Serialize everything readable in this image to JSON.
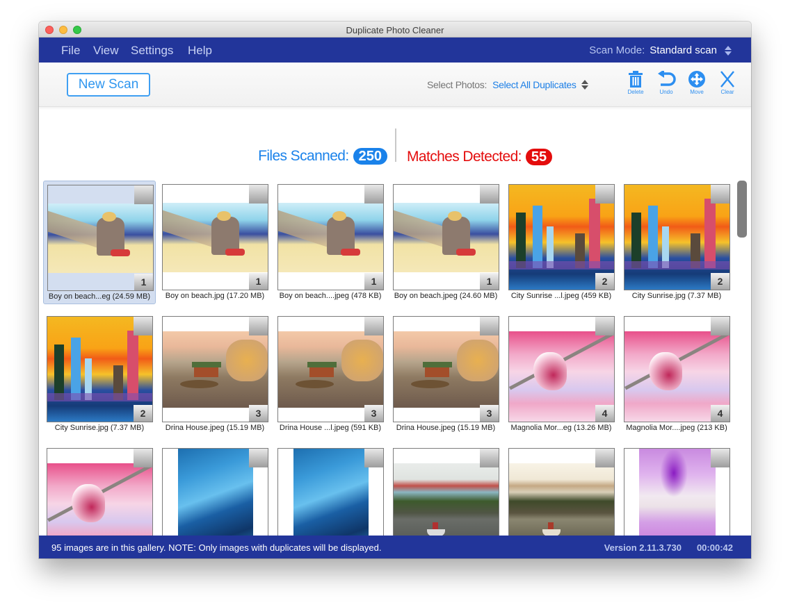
{
  "window": {
    "title": "Duplicate Photo Cleaner"
  },
  "menu": {
    "items": [
      {
        "label": "File"
      },
      {
        "label": "View"
      },
      {
        "label": "Settings"
      },
      {
        "label": "Help"
      }
    ],
    "scan_mode_label": "Scan Mode:",
    "scan_mode_value": "Standard scan"
  },
  "toolbar": {
    "new_scan_label": "New Scan",
    "select_photos_label": "Select Photos:",
    "select_photos_value": "Select All Duplicates",
    "tools": [
      {
        "label": "Delete",
        "icon": "trash-icon"
      },
      {
        "label": "Undo",
        "icon": "undo-icon"
      },
      {
        "label": "Move",
        "icon": "move-icon"
      },
      {
        "label": "Clear",
        "icon": "clear-icon"
      }
    ],
    "accent_color": "#2c8ef0"
  },
  "stats": {
    "files_scanned_label": "Files Scanned:",
    "files_scanned_value": "250",
    "matches_label": "Matches Detected:",
    "matches_value": "55"
  },
  "gallery": {
    "items": [
      {
        "caption": "Boy on beach...eg (24.59 MB)",
        "group": "1",
        "image": "beach",
        "selected": true
      },
      {
        "caption": "Boy on beach.jpg (17.20 MB)",
        "group": "1",
        "image": "beach"
      },
      {
        "caption": "Boy on beach....jpeg (478 KB)",
        "group": "1",
        "image": "beach"
      },
      {
        "caption": "Boy on beach.jpeg (24.60 MB)",
        "group": "1",
        "image": "beach"
      },
      {
        "caption": "City Sunrise ...l.jpeg (459 KB)",
        "group": "2",
        "image": "city"
      },
      {
        "caption": "City Sunrise.jpg (7.37 MB)",
        "group": "2",
        "image": "city"
      },
      {
        "caption": "City Sunrise.jpg (7.37 MB)",
        "group": "2",
        "image": "city"
      },
      {
        "caption": "Drina House.jpeg (15.19 MB)",
        "group": "3",
        "image": "house"
      },
      {
        "caption": "Drina House ...l.jpeg (591 KB)",
        "group": "3",
        "image": "house"
      },
      {
        "caption": "Drina House.jpeg (15.19 MB)",
        "group": "3",
        "image": "house"
      },
      {
        "caption": "Magnolia Mor...eg (13.26 MB)",
        "group": "4",
        "image": "magnolia"
      },
      {
        "caption": "Magnolia Mor....jpeg (213 KB)",
        "group": "4",
        "image": "magnolia"
      },
      {
        "caption": "",
        "group": "",
        "image": "magnolia"
      },
      {
        "caption": "",
        "group": "",
        "image": "wave"
      },
      {
        "caption": "",
        "group": "",
        "image": "wave"
      },
      {
        "caption": "",
        "group": "",
        "image": "harbor"
      },
      {
        "caption": "",
        "group": "",
        "image": "harbor-warm"
      },
      {
        "caption": "",
        "group": "",
        "image": "wisteria"
      }
    ]
  },
  "status": {
    "text": "95 images are in this gallery. NOTE: Only images with duplicates will be displayed.",
    "version": "Version 2.11.3.730",
    "timer": "00:00:42"
  }
}
